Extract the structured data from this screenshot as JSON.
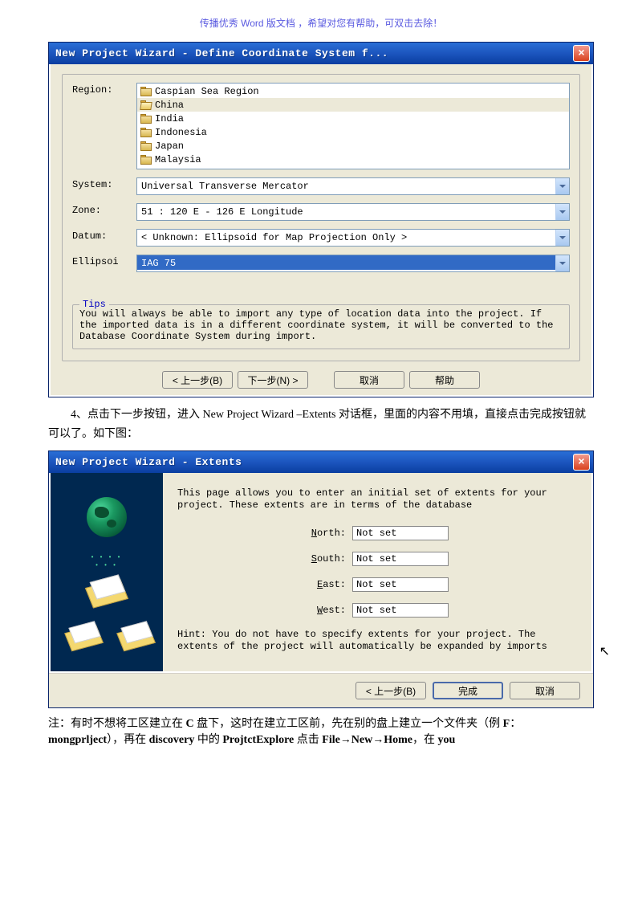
{
  "header": "传播优秀 Word 版文档 ，希望对您有帮助，可双击去除！",
  "dialog1": {
    "title": "New Project Wizard - Define Coordinate System f...",
    "labels": {
      "region": "Region:",
      "system": "System:",
      "zone": "Zone:",
      "datum": "Datum:",
      "ellipsoi": "Ellipsoi"
    },
    "regions": [
      "Caspian Sea Region",
      "China",
      "India",
      "Indonesia",
      "Japan",
      "Malaysia"
    ],
    "selected_region_index": 1,
    "system_value": "Universal Transverse Mercator",
    "zone_value": "51 :  120 E - 126 E Longitude",
    "datum_value": "< Unknown: Ellipsoid for Map Projection Only >",
    "ellipsoi_value": "IAG 75",
    "tips_label": "Tips",
    "tips_text": "You will always be able to import any type of location data into the project. If the imported data is in a different coordinate system, it will be converted to the Database Coordinate System during import.",
    "btn_back": "< 上一步(B)",
    "btn_next": "下一步(N) >",
    "btn_cancel": "取消",
    "btn_help": "帮助"
  },
  "doc_text_1": "4、点击下一步按钮，进入 New Project Wizard –Extents 对话框，里面的内容不用填，直接点击完成按钮就可以了。如下图：",
  "dialog2": {
    "title": "New Project Wizard - Extents",
    "desc": "This page allows you to enter an initial set of extents for your project.  These extents are in terms of the database",
    "north_label": "North:",
    "south_label": "South:",
    "east_label": "East:",
    "west_label": "West:",
    "not_set": "Not set",
    "hint": "Hint:  You do not have to specify extents for your project.  The extents of the project will automatically be expanded by imports",
    "btn_back": "< 上一步(B)",
    "btn_finish": "完成",
    "btn_cancel": "取消"
  },
  "note_text": "注：有时不想将工区建立在 C 盘下，这时在建立工区前，先在别的盘上建立一个文件夹（例 F：mongprlject），再在 discovery 中的 ProjtctExplore 点击 File→New→Home，在 you"
}
